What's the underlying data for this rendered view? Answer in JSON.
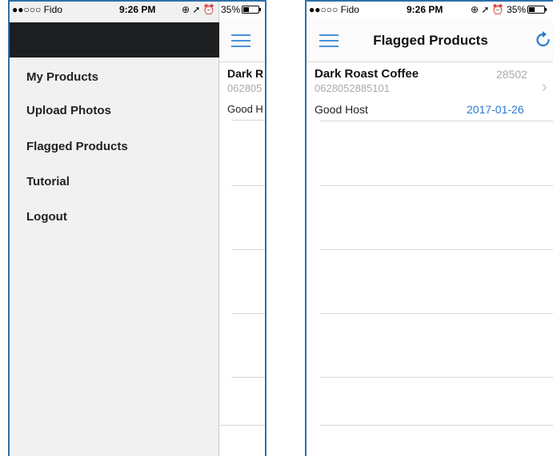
{
  "left_phone": {
    "status": {
      "carrier": "●●○○○ Fido",
      "time": "9:26 PM",
      "battery_text": "35%",
      "battery_level": 0.35
    },
    "menu": [
      {
        "label": "My Products"
      },
      {
        "label": "Upload Photos"
      },
      {
        "label": "Flagged Products"
      },
      {
        "label": "Tutorial"
      },
      {
        "label": "Logout"
      }
    ],
    "peek": {
      "name": "Dark R",
      "code": "062805",
      "host": "Good H"
    }
  },
  "right_phone": {
    "status": {
      "carrier": "●●○○○ Fido",
      "time": "9:26 PM",
      "battery_text": "35%",
      "battery_level": 0.35
    },
    "title": "Flagged Products",
    "item": {
      "name": "Dark Roast Coffee",
      "id": "28502",
      "barcode": "0628052885101",
      "host": "Good Host",
      "date": "2017-01-26",
      "chevron": "›"
    },
    "icons": {
      "menu": "hamburger-icon",
      "refresh": "refresh-icon",
      "chevron": "chevron-right-icon"
    },
    "accent_color": "#2b79d0"
  }
}
